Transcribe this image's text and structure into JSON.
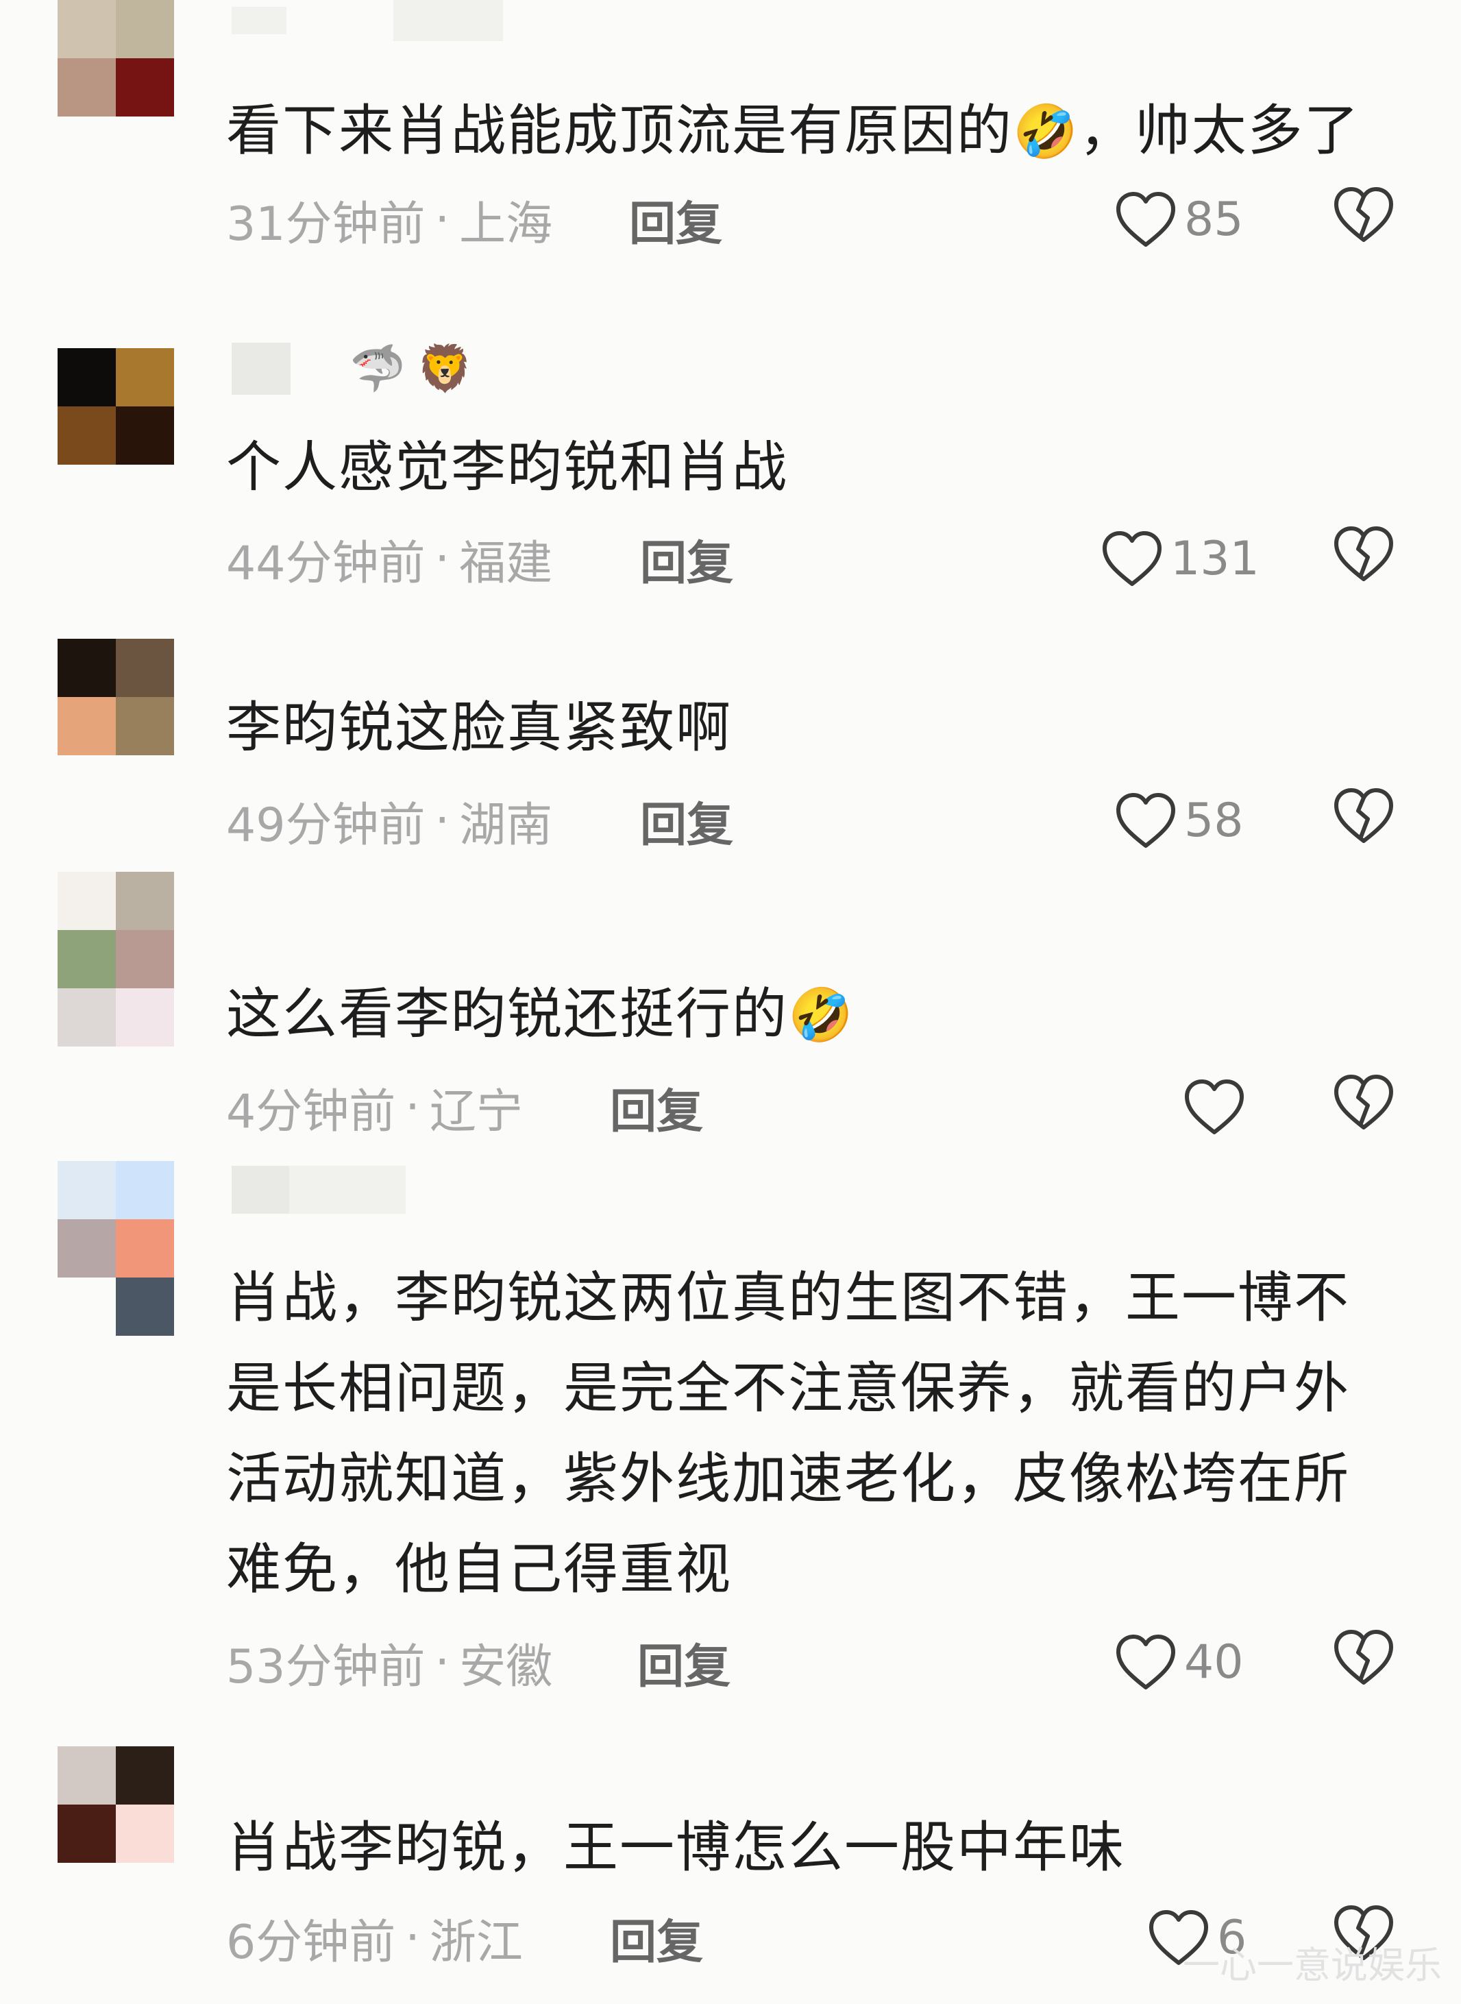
{
  "comments": [
    {
      "avatar": [
        "#cfc3b0",
        "#c0b59d",
        "#b99684",
        "#751412"
      ],
      "text": "看下来肖战能成顶流是有原因的",
      "emoji_after": "🤣",
      "text_tail": "，帅太多了",
      "time": "31分钟前",
      "location": "上海",
      "reply_label": "回复",
      "likes": "85"
    },
    {
      "avatar": [
        "#0d0c0b",
        "#a9782f",
        "#7a4a1c",
        "#291409"
      ],
      "name_emojis": [
        "🦈",
        "🦁"
      ],
      "text": "个人感觉李昀锐和肖战",
      "time": "44分钟前",
      "location": "福建",
      "reply_label": "回复",
      "likes": "131"
    },
    {
      "avatar": [
        "#1d140d",
        "#6b5440",
        "#e6a47b",
        "#98805d"
      ],
      "text": "李昀锐这脸真紧致啊",
      "time": "49分钟前",
      "location": "湖南",
      "reply_label": "回复",
      "likes": "58"
    },
    {
      "avatar": [
        "#f4f1ec",
        "#bbb1a3",
        "#8ea37a",
        "#b99a93",
        "#ddd8d5",
        "#f3e6ea"
      ],
      "text": "这么看李昀锐还挺行的",
      "emoji_after": "🤣",
      "time": "4分钟前",
      "location": "辽宁",
      "reply_label": "回复",
      "likes": ""
    },
    {
      "avatar": [
        "#dfeaf4",
        "#cfe3fa",
        "#b7a6a6",
        "#f2967a",
        "#fbfbf9",
        "#4b5765"
      ],
      "text": "肖战，李昀锐这两位真的生图不错，王一博不是长相问题，是完全不注意保养，就看的户外活动就知道，紫外线加速老化，皮像松垮在所难免，他自己得重视",
      "lines": [
        "肖战，李昀锐这两位真的生图不错，王一博不",
        "是长相问题，是完全不注意保养，就看的户外",
        "活动就知道，紫外线加速老化，皮像松垮在所",
        "难免，他自己得重视"
      ],
      "time": "53分钟前",
      "location": "安徽",
      "reply_label": "回复",
      "likes": "40"
    },
    {
      "avatar": [
        "#d2c9c4",
        "#2c1f17",
        "#4a1e14",
        "#f9ddd6"
      ],
      "text": "肖战李昀锐，王一博怎么一股中年味",
      "time": "6分钟前",
      "location": "浙江",
      "reply_label": "回复",
      "likes": "6"
    }
  ],
  "separator": "·",
  "watermark": "一心一意说娱乐",
  "icons": {
    "like": "heart-outline-icon",
    "dislike": "broken-heart-icon"
  },
  "colors": {
    "background": "#fbfbf9",
    "text": "#1e1e1e",
    "meta": "#a8a8a8",
    "reply": "#666666"
  }
}
